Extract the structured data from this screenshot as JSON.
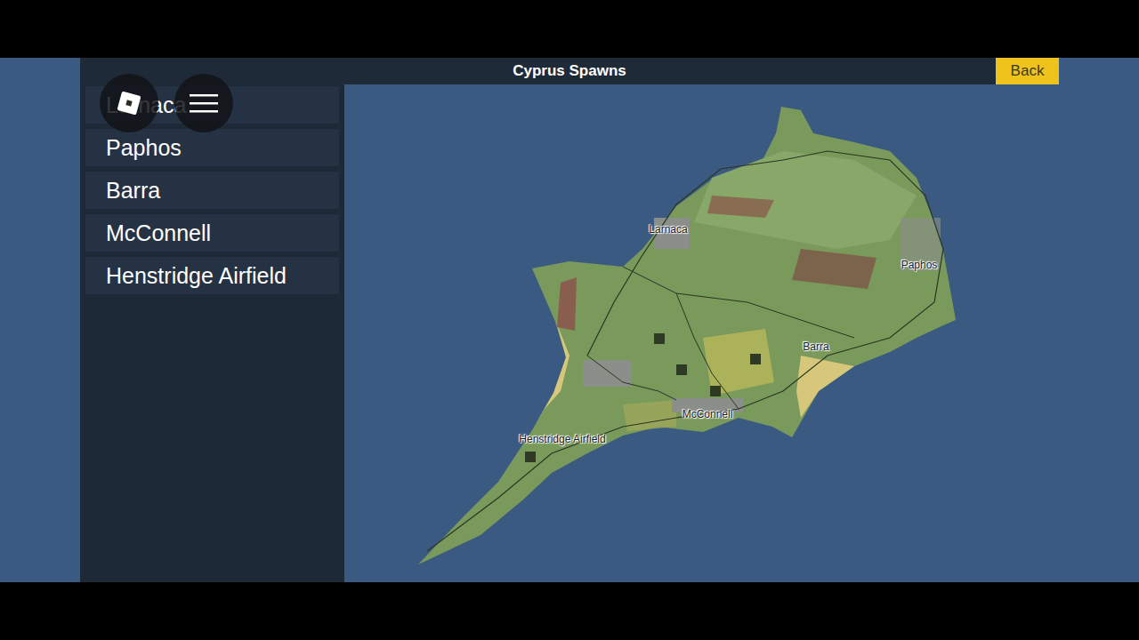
{
  "window": {
    "title": "Cyprus Spawns"
  },
  "back_button": {
    "label": "Back"
  },
  "sidebar": {
    "items": [
      "Larnaca",
      "Paphos",
      "Barra",
      "McConnell",
      "Henstridge Airfield"
    ]
  },
  "map": {
    "labels": [
      "Larnaca",
      "Paphos",
      "Barra",
      "McConnell",
      "Henstridge Airfield"
    ]
  }
}
